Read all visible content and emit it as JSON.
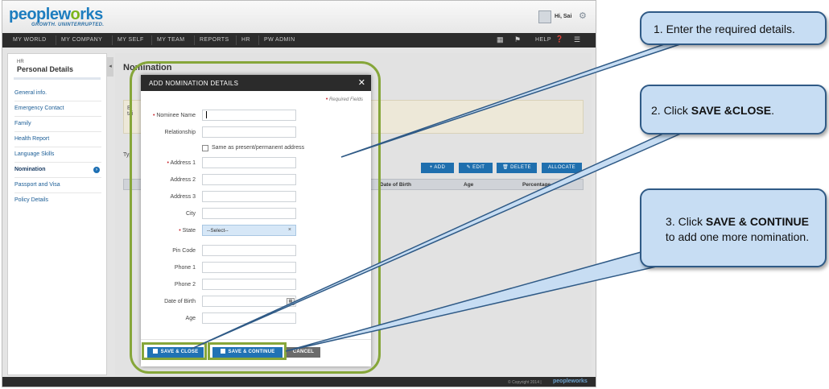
{
  "app": {
    "logo_main": "peoplew",
    "logo_o": "o",
    "logo_end": "rks",
    "tagline": "GROWTH. UNINTERRUPTED.",
    "user_greeting": "Hi, Sai",
    "nav": [
      "MY WORLD",
      "MY COMPANY",
      "MY SELF",
      "MY TEAM",
      "REPORTS",
      "HR",
      "PW ADMIN"
    ],
    "nav_help": "HELP",
    "footer_copy": "© Copyright 2014 |",
    "footer_logo": "peopleworks"
  },
  "sidebar": {
    "sub": "HR",
    "title": "Personal Details",
    "items": [
      "General info.",
      "Emergency Contact",
      "Family",
      "Health Report",
      "Language Skills",
      "Nomination",
      "Passport and Visa",
      "Policy Details"
    ],
    "active_index": 5
  },
  "main": {
    "title": "Nomination",
    "info_letter": "E",
    "info_letter2": "tai",
    "type_label": "Typ",
    "actions": [
      "ADD",
      "EDIT",
      "DELETE",
      "ALLOCATE"
    ],
    "table_headers": [
      "Date of Birth",
      "Age",
      "Percentage"
    ]
  },
  "modal": {
    "title": "ADD NOMINATION DETAILS",
    "required_note": "Required Fields",
    "fields": {
      "nominee_name": "Nominee Name",
      "relationship": "Relationship",
      "same_address": "Same as present/permanent address",
      "address1": "Address 1",
      "address2": "Address 2",
      "address3": "Address 3",
      "city": "City",
      "state": "State",
      "state_value": "--Select--",
      "pin_code": "Pin Code",
      "phone1": "Phone 1",
      "phone2": "Phone 2",
      "dob": "Date of Birth",
      "age": "Age"
    },
    "buttons": {
      "save_close": "SAVE & CLOSE",
      "save_continue": "SAVE & CONTINUE",
      "cancel": "CANCEL"
    }
  },
  "callouts": {
    "c1": "1. Enter the required details.",
    "c2_prefix": "2. Click ",
    "c2_bold": "SAVE &CLOSE",
    "c2_suffix": ".",
    "c3_prefix": "3. Click ",
    "c3_bold": "SAVE & CONTINUE",
    "c3_line2": "to add one more nomination."
  },
  "colors": {
    "accent_blue": "#2072b4",
    "highlight_green": "#86a63a",
    "callout_fill": "#c7ddf3",
    "callout_border": "#2f5a86"
  }
}
